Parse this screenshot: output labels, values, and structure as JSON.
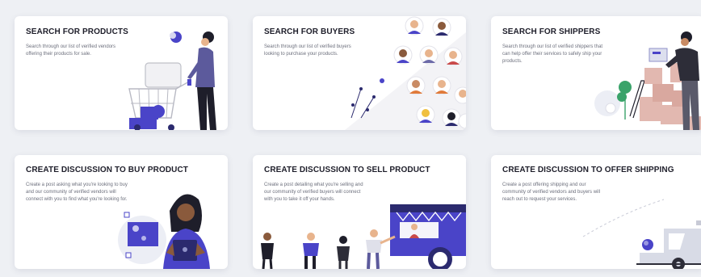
{
  "cards": [
    {
      "title": "SEARCH FOR PRODUCTS",
      "description": "Search through our list of verified vendors offering their products for sale.",
      "icon": "shopping-cart-illustration"
    },
    {
      "title": "SEARCH FOR BUYERS",
      "description": "Search through our list of verified buyers looking to purchase your products.",
      "icon": "buyers-network-illustration"
    },
    {
      "title": "SEARCH FOR SHIPPERS",
      "description": "Search through our list of verified shippers that can help offer their services to safely ship your products.",
      "icon": "shipper-boxes-illustration"
    },
    {
      "title": "CREATE DISCUSSION TO BUY PRODUCT",
      "description": "Create a post asking what you're looking to buy and our community of verified vendors will connect with you to find what you're looking for.",
      "icon": "buyer-tablet-illustration"
    },
    {
      "title": "CREATE DISCUSSION TO SELL PRODUCT",
      "description": "Create a post detailing what you're selling and our community of verified buyers will connect with you to take it off your hands.",
      "icon": "seller-food-truck-illustration"
    },
    {
      "title": "CREATE DISCUSSION TO OFFER SHIPPING",
      "description": "Create a post offering shipping and our community of verified vendors and buyers will reach out to request your services.",
      "icon": "delivery-truck-illustration"
    }
  ],
  "colors": {
    "accent": "#4a44c8",
    "accent_dark": "#2b2a6e",
    "skin_tan": "#e8b48d",
    "box_pink": "#e2b8b0",
    "truck_gray": "#d8dbe6"
  }
}
